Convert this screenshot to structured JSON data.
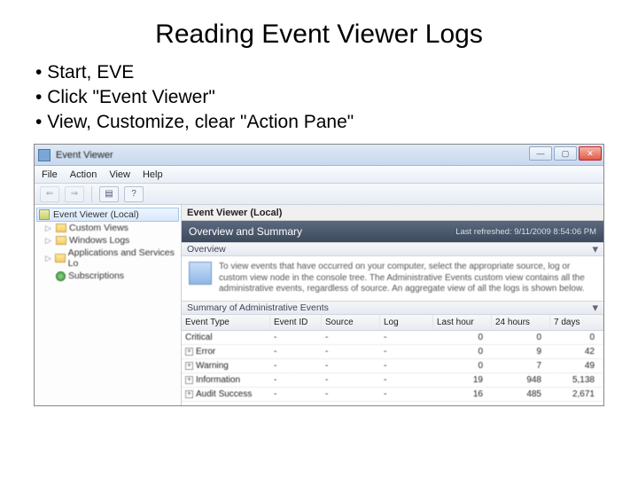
{
  "slide": {
    "title": "Reading Event Viewer Logs",
    "bullets": [
      "Start, EVE",
      "Click \"Event Viewer\"",
      "View, Customize, clear \"Action Pane\""
    ]
  },
  "window": {
    "title": "Event Viewer",
    "menus": [
      "File",
      "Action",
      "View",
      "Help"
    ]
  },
  "tree": {
    "root": "Event Viewer (Local)",
    "items": [
      "Custom Views",
      "Windows Logs",
      "Applications and Services Lo",
      "Subscriptions"
    ]
  },
  "content": {
    "header": "Event Viewer (Local)",
    "band_title": "Overview and Summary",
    "refreshed": "Last refreshed: 9/11/2009 8:54:06 PM",
    "overview_label": "Overview",
    "overview_text": "To view events that have occurred on your computer, select the appropriate source, log or custom view node in the console tree. The Administrative Events custom view contains all the administrative events, regardless of source. An aggregate view of all the logs is shown below.",
    "summary_label": "Summary of Administrative Events",
    "columns": [
      "Event Type",
      "Event ID",
      "Source",
      "Log",
      "Last hour",
      "24 hours",
      "7 days"
    ],
    "rows": [
      {
        "type": "Critical",
        "id": "-",
        "source": "-",
        "log": "-",
        "h1": "0",
        "h24": "0",
        "d7": "0"
      },
      {
        "type": "Error",
        "id": "-",
        "source": "-",
        "log": "-",
        "h1": "0",
        "h24": "9",
        "d7": "42"
      },
      {
        "type": "Warning",
        "id": "-",
        "source": "-",
        "log": "-",
        "h1": "0",
        "h24": "7",
        "d7": "49"
      },
      {
        "type": "Information",
        "id": "-",
        "source": "-",
        "log": "-",
        "h1": "19",
        "h24": "948",
        "d7": "5,138"
      },
      {
        "type": "Audit Success",
        "id": "-",
        "source": "-",
        "log": "-",
        "h1": "16",
        "h24": "485",
        "d7": "2,671"
      }
    ]
  }
}
